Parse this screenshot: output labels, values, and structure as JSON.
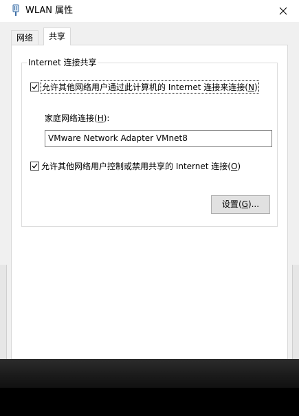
{
  "window": {
    "title": "WLAN 属性",
    "close_symbol": "✕"
  },
  "tabs": [
    {
      "label": "网络",
      "active": false
    },
    {
      "label": "共享",
      "active": true
    }
  ],
  "group": {
    "label": "Internet 连接共享"
  },
  "allow_share": {
    "checked": true,
    "text": "允许其他网络用户通过此计算机的 Internet 连接来连接",
    "accel_open": "(",
    "accel_key": "N",
    "accel_close": ")"
  },
  "home_network": {
    "label_text": "家庭网络连接",
    "accel_open": "(",
    "accel_key": "H",
    "accel_close": "):",
    "value": "VMware Network Adapter VMnet8"
  },
  "allow_control": {
    "checked": true,
    "text": "允许其他网络用户控制或禁用共享的 Internet 连接",
    "accel_open": "(",
    "accel_key": "O",
    "accel_close": ")"
  },
  "settings_button": {
    "text": "设置",
    "accel_open": "(",
    "accel_key": "G",
    "accel_close": ")..."
  },
  "icons": {
    "title_icon": "network-adapter-icon",
    "close_icon": "close-icon",
    "checkmark": "checkmark-icon"
  }
}
